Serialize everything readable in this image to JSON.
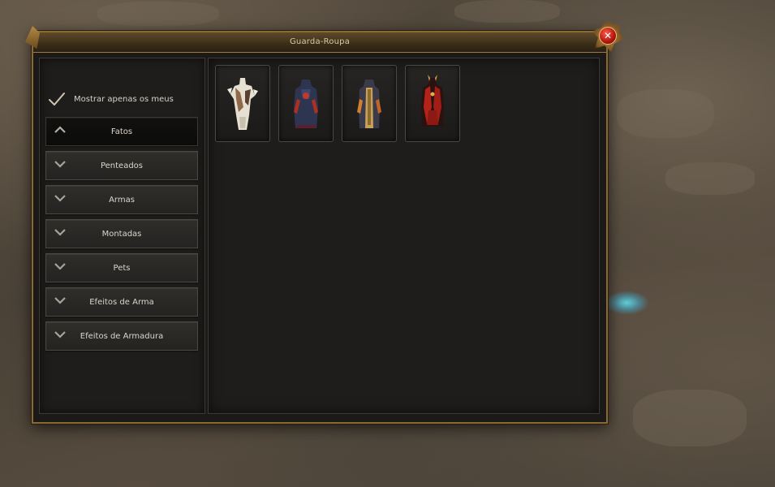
{
  "window": {
    "title": "Guarda-Roupa"
  },
  "filter": {
    "label": "Mostrar apenas os meus",
    "checked": true
  },
  "categories": [
    {
      "label": "Fatos",
      "expanded": true
    },
    {
      "label": "Penteados",
      "expanded": false
    },
    {
      "label": "Armas",
      "expanded": false
    },
    {
      "label": "Montadas",
      "expanded": false
    },
    {
      "label": "Pets",
      "expanded": false
    },
    {
      "label": "Efeitos de Arma",
      "expanded": false
    },
    {
      "label": "Efeitos de Armadura",
      "expanded": false
    }
  ],
  "items": [
    {
      "icon": "white-armor-costume-icon"
    },
    {
      "icon": "dark-blue-robe-costume-icon"
    },
    {
      "icon": "brown-robe-costume-icon"
    },
    {
      "icon": "red-demon-costume-icon"
    }
  ],
  "colors": {
    "border_gold": "#8a6a34",
    "close_red": "#b1160e",
    "panel_bg": "#1e1d1b"
  }
}
